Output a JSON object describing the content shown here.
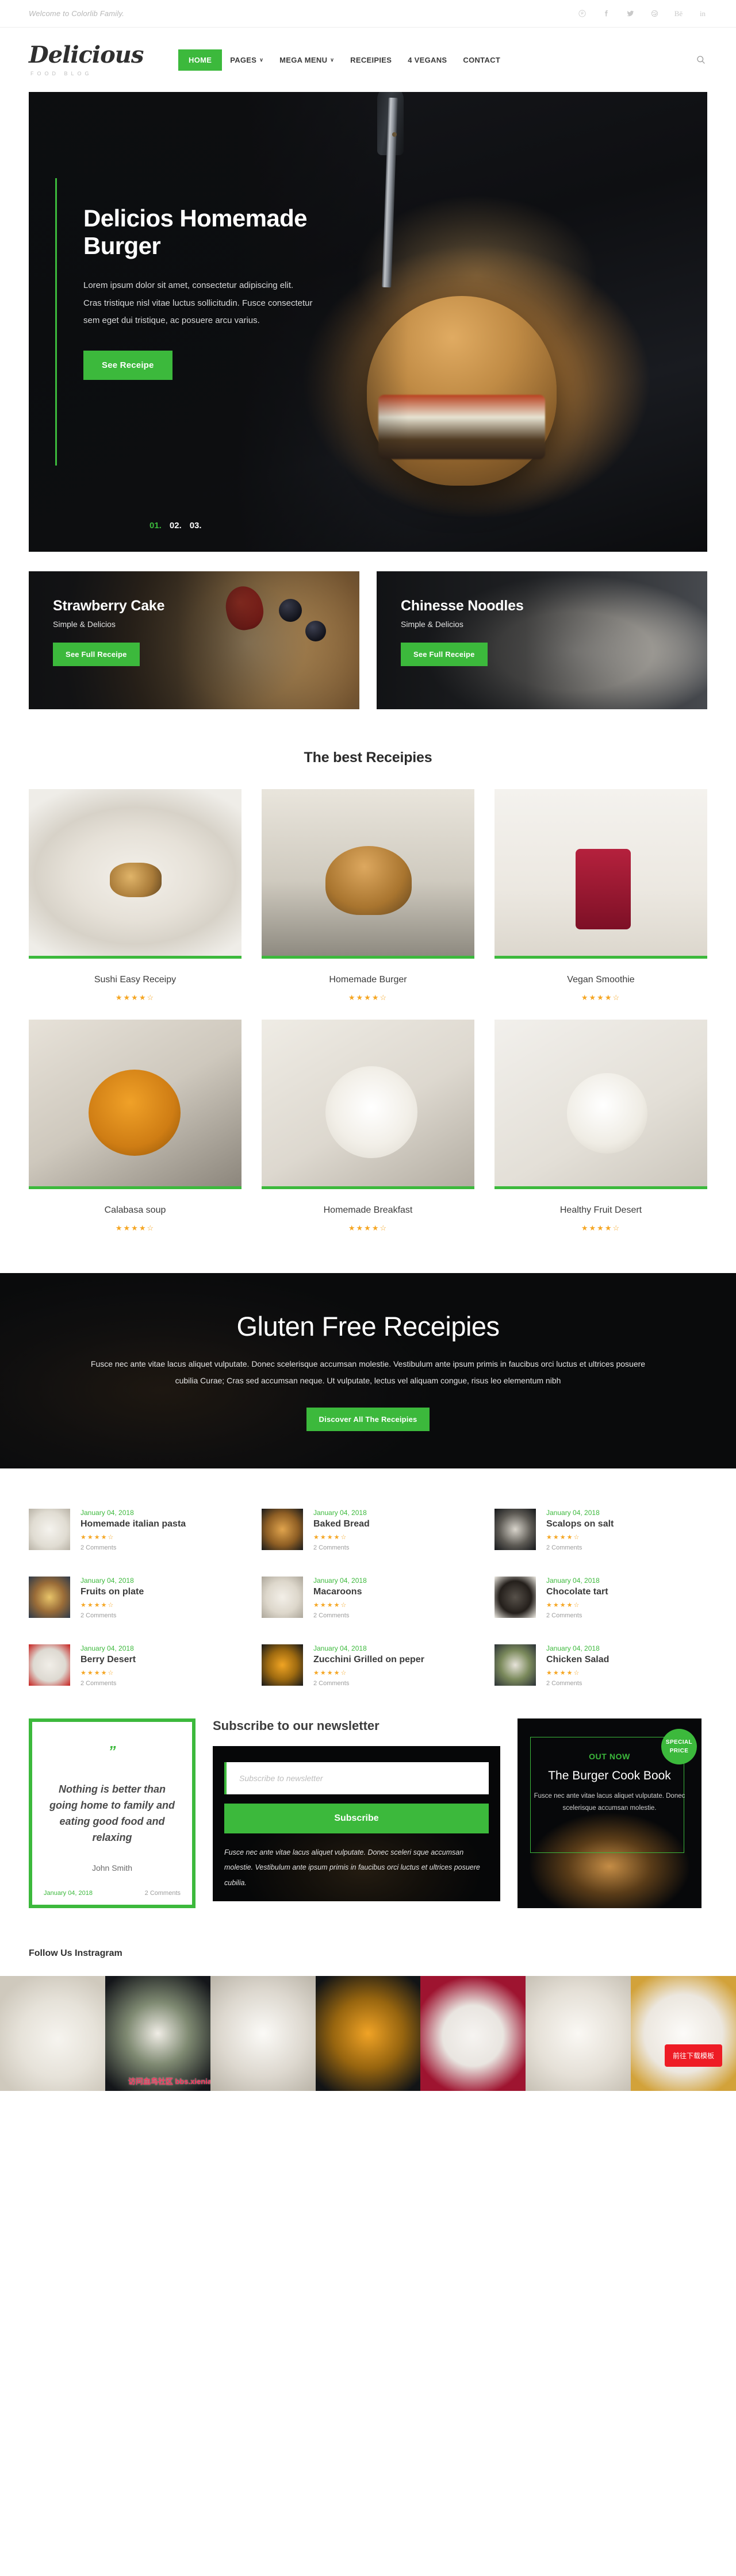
{
  "topbar": {
    "message": "Welcome to Colorlib Family.",
    "social": [
      {
        "name": "pinterest-icon",
        "glyph": "Ⓟ"
      },
      {
        "name": "facebook-icon",
        "glyph": "f"
      },
      {
        "name": "twitter-icon",
        "glyph": "ᴠ"
      },
      {
        "name": "dribbble-icon",
        "glyph": "⊛"
      },
      {
        "name": "behance-icon",
        "glyph": "Bē"
      },
      {
        "name": "linkedin-icon",
        "glyph": "in"
      }
    ]
  },
  "header": {
    "logo_name": "Delicious",
    "logo_sub": "FOOD BLOG",
    "nav": [
      {
        "label": "HOME",
        "active": true,
        "caret": ""
      },
      {
        "label": "PAGES",
        "active": false,
        "caret": "∨"
      },
      {
        "label": "MEGA MENU",
        "active": false,
        "caret": "∨"
      },
      {
        "label": "RECEIPIES",
        "active": false,
        "caret": ""
      },
      {
        "label": "4 VEGANS",
        "active": false,
        "caret": ""
      },
      {
        "label": "CONTACT",
        "active": false,
        "caret": ""
      }
    ],
    "search_icon": "search-icon"
  },
  "hero": {
    "title": "Delicios Homemade Burger",
    "text": "Lorem ipsum dolor sit amet, consectetur adipiscing elit. Cras tristique nisl vitae luctus sollicitudin. Fusce consectetur sem eget dui tristique, ac posuere arcu varius.",
    "cta": "See Receipe",
    "slides": [
      "01.",
      "02.",
      "03."
    ],
    "active_slide": "01."
  },
  "features": [
    {
      "title": "Strawberry Cake",
      "subtitle": "Simple & Delicios",
      "cta": "See Full Receipe"
    },
    {
      "title": "Chinesse Noodles",
      "subtitle": "Simple & Delicios",
      "cta": "See Full Receipe"
    }
  ],
  "recipes_section": {
    "title": "The best Receipies",
    "items": [
      {
        "name": "Sushi Easy Receipy",
        "rating": 4,
        "max": 5
      },
      {
        "name": "Homemade Burger",
        "rating": 4,
        "max": 5
      },
      {
        "name": "Vegan Smoothie",
        "rating": 4,
        "max": 5
      },
      {
        "name": "Calabasa soup",
        "rating": 4,
        "max": 5
      },
      {
        "name": "Homemade Breakfast",
        "rating": 4,
        "max": 5
      },
      {
        "name": "Healthy Fruit Desert",
        "rating": 4,
        "max": 5
      }
    ],
    "stars_filled": "★★★★",
    "stars_empty": "☆"
  },
  "gluten": {
    "title": "Gluten Free Receipies",
    "text": "Fusce nec ante vitae lacus aliquet vulputate. Donec scelerisque accumsan molestie. Vestibulum ante ipsum primis in faucibus orci luctus et ultrices posuere cubilia Curae; Cras sed accumsan neque. Ut vulputate, lectus vel aliquam congue, risus leo elementum nibh",
    "cta": "Discover All The Receipies"
  },
  "blog": {
    "items": [
      {
        "date": "January 04, 2018",
        "title": "Homemade italian pasta",
        "comments": "2 Comments",
        "rating": 4
      },
      {
        "date": "January 04, 2018",
        "title": "Baked Bread",
        "comments": "2 Comments",
        "rating": 4
      },
      {
        "date": "January 04, 2018",
        "title": "Scalops on salt",
        "comments": "2 Comments",
        "rating": 4
      },
      {
        "date": "January 04, 2018",
        "title": "Fruits on plate",
        "comments": "2 Comments",
        "rating": 4
      },
      {
        "date": "January 04, 2018",
        "title": "Macaroons",
        "comments": "2 Comments",
        "rating": 4
      },
      {
        "date": "January 04, 2018",
        "title": "Chocolate tart",
        "comments": "2 Comments",
        "rating": 4
      },
      {
        "date": "January 04, 2018",
        "title": "Berry Desert",
        "comments": "2 Comments",
        "rating": 4
      },
      {
        "date": "January 04, 2018",
        "title": "Zucchini Grilled on peper",
        "comments": "2 Comments",
        "rating": 4
      },
      {
        "date": "January 04, 2018",
        "title": "Chicken Salad",
        "comments": "2 Comments",
        "rating": 4
      }
    ]
  },
  "quote": {
    "mark": "”",
    "text": "Nothing is better than going home to family and eating good food and relaxing",
    "author": "John Smith",
    "date": "January 04, 2018",
    "comments": "2 Comments"
  },
  "newsletter": {
    "title": "Subscribe to our newsletter",
    "placeholder": "Subscribe to newsletter",
    "value": "",
    "button": "Subscribe",
    "note": "Fusce nec ante vitae lacus aliquet vulputate. Donec sceleri sque accumsan molestie. Vestibulum ante ipsum primis in faucibus orci luctus et ultrices posuere cubilia."
  },
  "book": {
    "badge_line1": "SPECIAL",
    "badge_line2": "PRICE",
    "eyebrow": "OUT NOW",
    "title": "The Burger Cook Book",
    "desc": "Fusce nec ante vitae lacus aliquet vulputate. Donec scelerisque accumsan molestie."
  },
  "instagram": {
    "title": "Follow Us Instragram",
    "cells": 7,
    "watermark": "访问血鸟社区 bbs.xieniao.com 免费下载更多内容",
    "download_button": "前往下载模板"
  },
  "colors": {
    "accent_green": "#3cb93c",
    "star_gold": "#f5a623",
    "dark": "#0c0d0f",
    "download_red": "#ee1c25"
  }
}
